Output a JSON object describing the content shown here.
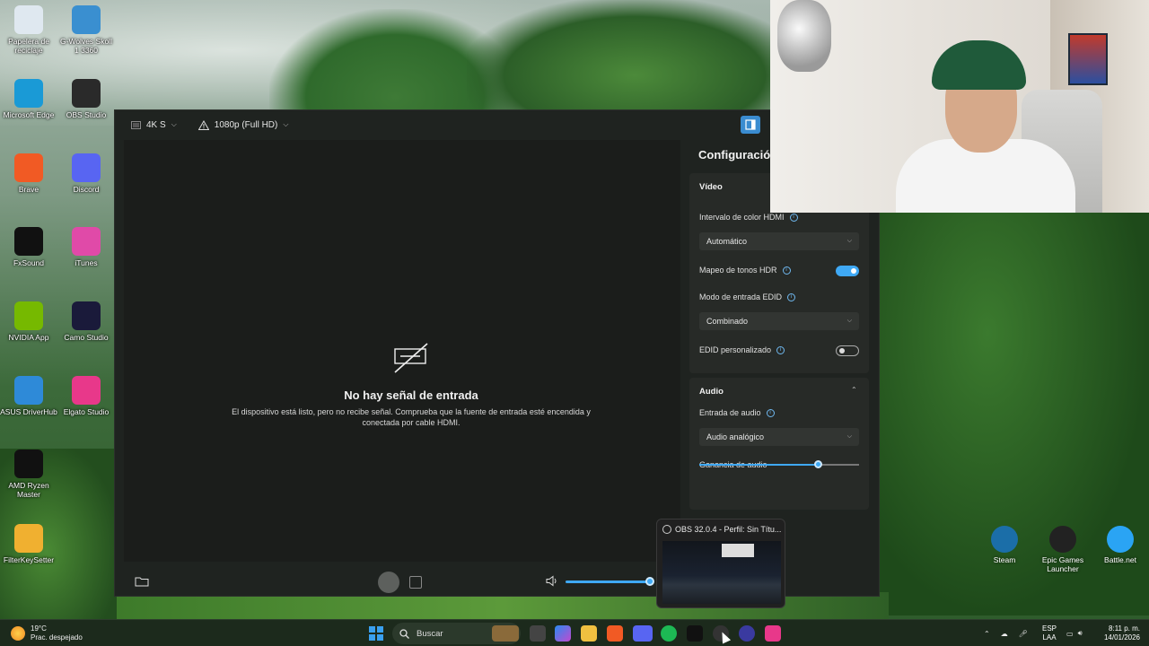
{
  "desktop": {
    "left_icons": [
      {
        "label": "Papelera de reciclaje",
        "icon": "recycle-bin-icon",
        "color": "#dfe8f0"
      },
      {
        "label": "G-Wolves Skoll 1 3360",
        "icon": "gwolves-icon",
        "color": "#3a8fd0"
      },
      {
        "label": "Microsoft Edge",
        "icon": "edge-icon",
        "color": "#1a9ad6"
      },
      {
        "label": "OBS Studio",
        "icon": "obs-icon",
        "color": "#2a2a2a"
      },
      {
        "label": "Brave",
        "icon": "brave-icon",
        "color": "#f15a24"
      },
      {
        "label": "Discord",
        "icon": "discord-icon",
        "color": "#5865f2"
      },
      {
        "label": "FxSound",
        "icon": "fxsound-icon",
        "color": "#111111"
      },
      {
        "label": "iTunes",
        "icon": "itunes-icon",
        "color": "#e04aa8"
      },
      {
        "label": "NVIDIA App",
        "icon": "nvidia-icon",
        "color": "#76b900"
      },
      {
        "label": "Camo Studio",
        "icon": "camo-icon",
        "color": "#1a1a3a"
      },
      {
        "label": "ASUS DriverHub",
        "icon": "asus-driverhub-icon",
        "color": "#2e8ad8"
      },
      {
        "label": "Elgato Studio",
        "icon": "elgato-icon",
        "color": "#e8388a"
      },
      {
        "label": "AMD Ryzen Master",
        "icon": "amd-ryzen-icon",
        "color": "#111111"
      },
      {
        "label": "FilterKeySetter",
        "icon": "filterkey-icon",
        "color": "#f0b030"
      }
    ],
    "right_icons": [
      {
        "label": "Steam",
        "icon": "steam-icon",
        "color": "#1b6ea8"
      },
      {
        "label": "Epic Games Launcher",
        "icon": "epic-games-icon",
        "color": "#222222"
      },
      {
        "label": "Battle.net",
        "icon": "battlenet-icon",
        "color": "#2aa4f4"
      }
    ]
  },
  "capture_window": {
    "topbar": {
      "device_label": "4K S",
      "resolution_label": "1080p (Full HD)"
    },
    "preview": {
      "title": "No hay señal de entrada",
      "description": "El dispositivo está listo, pero no recibe señal. Comprueba que la fuente de entrada esté encendida y conectada por cable HDMI."
    },
    "settings": {
      "title": "Configuración",
      "video": {
        "header": "Vídeo",
        "hdmi_range_label": "Intervalo de color HDMI",
        "hdmi_range_value": "Automático",
        "hdr_tonemap_label": "Mapeo de tonos HDR",
        "hdr_tonemap_on": true,
        "edid_mode_label": "Modo de entrada EDID",
        "edid_mode_value": "Combinado",
        "custom_edid_label": "EDID personalizado",
        "custom_edid_on": false
      },
      "audio": {
        "header": "Audio",
        "audio_input_label": "Entrada de audio",
        "audio_input_value": "Audio analógico",
        "gain_label": "Ganancia de audio",
        "gain_fraction": 0.74
      }
    },
    "volume_fraction": 1.0
  },
  "obs_preview": {
    "title": "OBS 32.0.4 - Perfil: Sin Títu..."
  },
  "taskbar": {
    "weather_temp": "19°C",
    "weather_desc": "Prac. despejado",
    "search_placeholder": "Buscar",
    "lang_top": "ESP",
    "lang_bottom": "LAA",
    "time": "8:11 p. m.",
    "date": "14/01/2026",
    "accent": "#3aa0f0"
  }
}
